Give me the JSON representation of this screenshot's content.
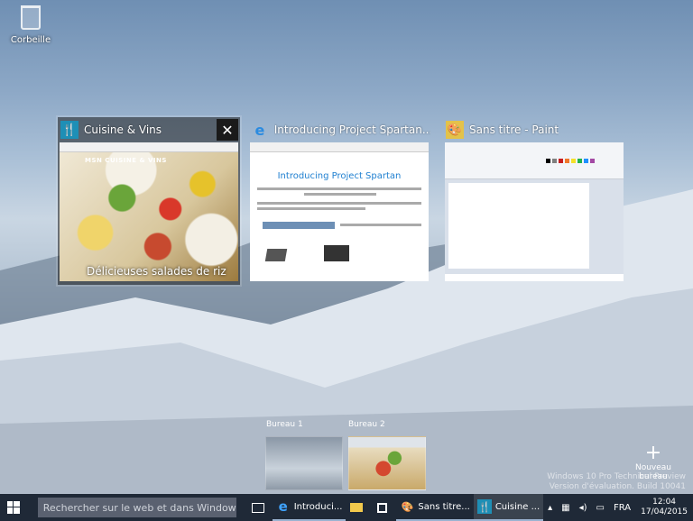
{
  "desktop": {
    "recycle_label": "Corbeille"
  },
  "windows": [
    {
      "title": "Cuisine & Vins",
      "icon": "fork-knife-icon",
      "accent": "#1e8fb6",
      "brand": "MSN CUISINE & VINS",
      "caption": "Délicieuses salades de riz"
    },
    {
      "title": "Introducing Project Spartan...",
      "icon": "internet-explorer-icon",
      "accent": "#1e7fd0",
      "doc_heading": "Introducing Project Spartan"
    },
    {
      "title": "Sans titre - Paint",
      "icon": "paint-palette-icon",
      "accent": "#2a7fd0"
    }
  ],
  "desktops": [
    {
      "label": "Bureau 1"
    },
    {
      "label": "Bureau 2"
    }
  ],
  "new_desktop": {
    "label": "Nouveau bureau"
  },
  "watermark": {
    "line1": "Windows 10 Pro Technical Preview",
    "line2": "Version d'évaluation. Build 10041"
  },
  "taskbar": {
    "search_placeholder": "Rechercher sur le web et dans Windows",
    "items": [
      {
        "label": "Introduci..."
      },
      {
        "label": "Sans titre..."
      },
      {
        "label": "Cuisine ..."
      }
    ],
    "language": "FRA",
    "time": "12:04",
    "date": "17/04/2015"
  }
}
